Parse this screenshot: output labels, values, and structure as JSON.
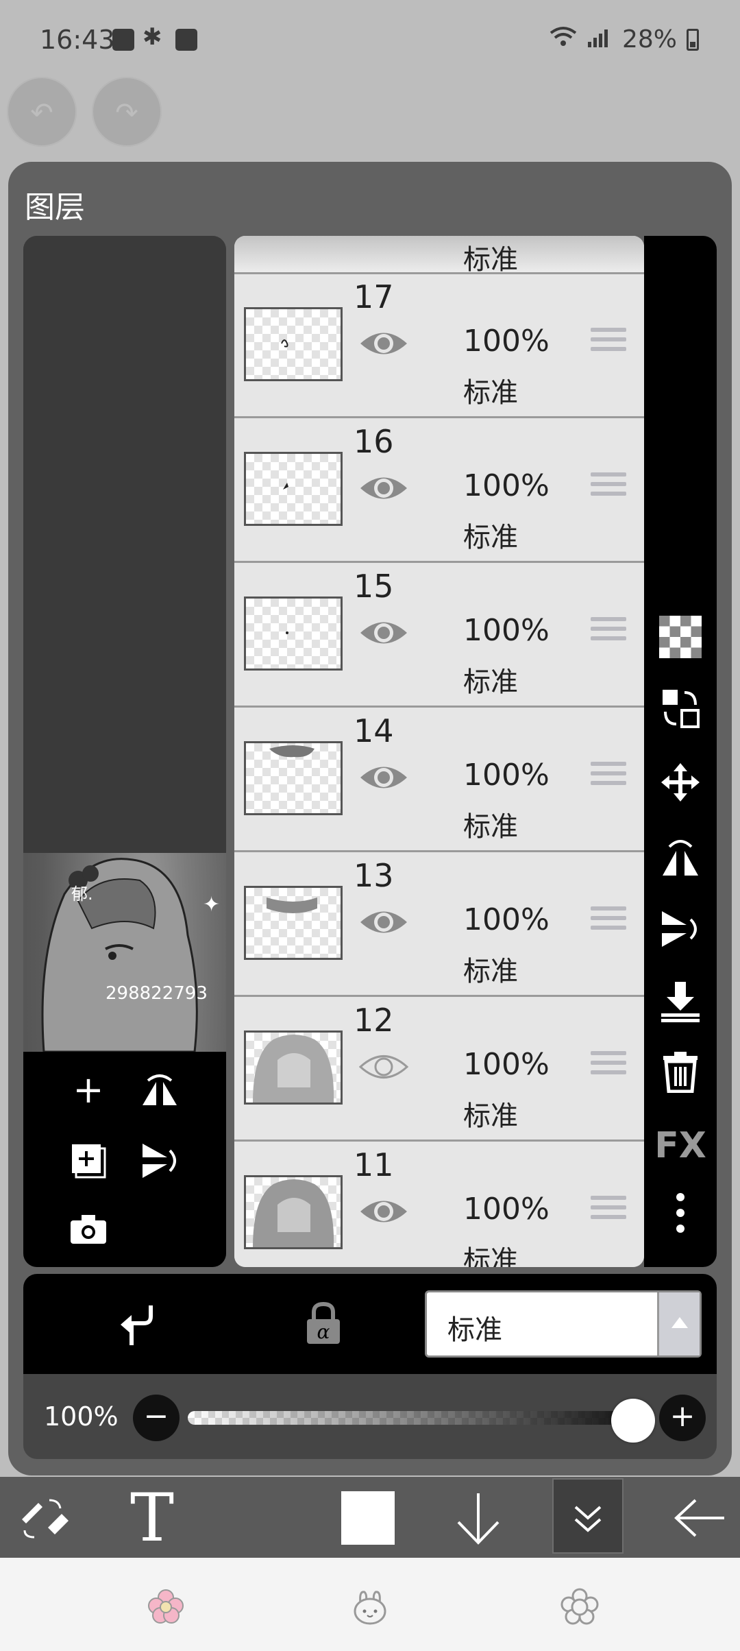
{
  "status_bar": {
    "time": "16:43",
    "battery": "28%",
    "icons": [
      "gallery-icon",
      "accessibility-icon",
      "calendar-icon",
      "wifi-icon",
      "signal-icon",
      "battery-icon"
    ]
  },
  "panel": {
    "title": "图层"
  },
  "preview": {
    "watermark": "郁.",
    "number": "298822793"
  },
  "layers": [
    {
      "number": "",
      "opacity": "",
      "mode": "标准",
      "visible": true
    },
    {
      "number": "17",
      "opacity": "100%",
      "mode": "标准",
      "visible": true
    },
    {
      "number": "16",
      "opacity": "100%",
      "mode": "标准",
      "visible": true
    },
    {
      "number": "15",
      "opacity": "100%",
      "mode": "标准",
      "visible": true
    },
    {
      "number": "14",
      "opacity": "100%",
      "mode": "标准",
      "visible": true
    },
    {
      "number": "13",
      "opacity": "100%",
      "mode": "标准",
      "visible": true
    },
    {
      "number": "12",
      "opacity": "100%",
      "mode": "标准",
      "visible": false
    },
    {
      "number": "11",
      "opacity": "100%",
      "mode": "标准",
      "visible": true
    }
  ],
  "right_toolbar": {
    "fx_label": "FX"
  },
  "blend": {
    "mode": "标准"
  },
  "opacity": {
    "label": "100%",
    "value": 1.0
  },
  "bottom_toolbar": {
    "text_tool_label": "T"
  },
  "colors": {
    "panel_bg": "#616161",
    "list_bg": "#e6e6e6",
    "toolbar_bg": "#000000"
  }
}
